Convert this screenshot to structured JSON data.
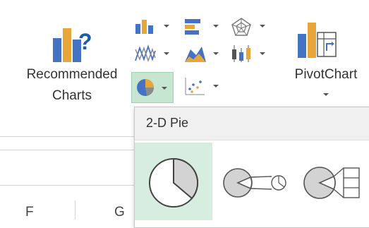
{
  "ribbon": {
    "recommended_charts": {
      "line1": "Recommended",
      "line2": "Charts",
      "icon": "recommended-charts-icon"
    },
    "pivot_chart": {
      "label": "PivotChart",
      "icon": "pivot-chart-icon"
    },
    "chart_type_buttons": [
      {
        "icon": "column-chart-icon"
      },
      {
        "icon": "bar-chart-icon"
      },
      {
        "icon": "radar-chart-icon"
      },
      {
        "icon": "line-chart-icon"
      },
      {
        "icon": "area-chart-icon"
      },
      {
        "icon": "stock-chart-icon"
      },
      {
        "icon": "pie-chart-icon",
        "active": true
      },
      {
        "icon": "scatter-chart-icon"
      }
    ]
  },
  "dropdown": {
    "section_title": "2-D Pie",
    "options": [
      {
        "name": "pie",
        "icon": "pie-icon",
        "selected": true
      },
      {
        "name": "pie-of-pie",
        "icon": "pie-of-pie-icon"
      },
      {
        "name": "bar-of-pie",
        "icon": "bar-of-pie-icon"
      }
    ]
  },
  "sheet": {
    "columns": [
      "F",
      "G"
    ]
  },
  "colors": {
    "excel_green_highlight": "#d6ede0",
    "excel_green_active": "#c6e6d2",
    "chart_blue": "#4472c4",
    "chart_orange": "#e8a53a",
    "icon_gray": "#8a8a8a"
  }
}
